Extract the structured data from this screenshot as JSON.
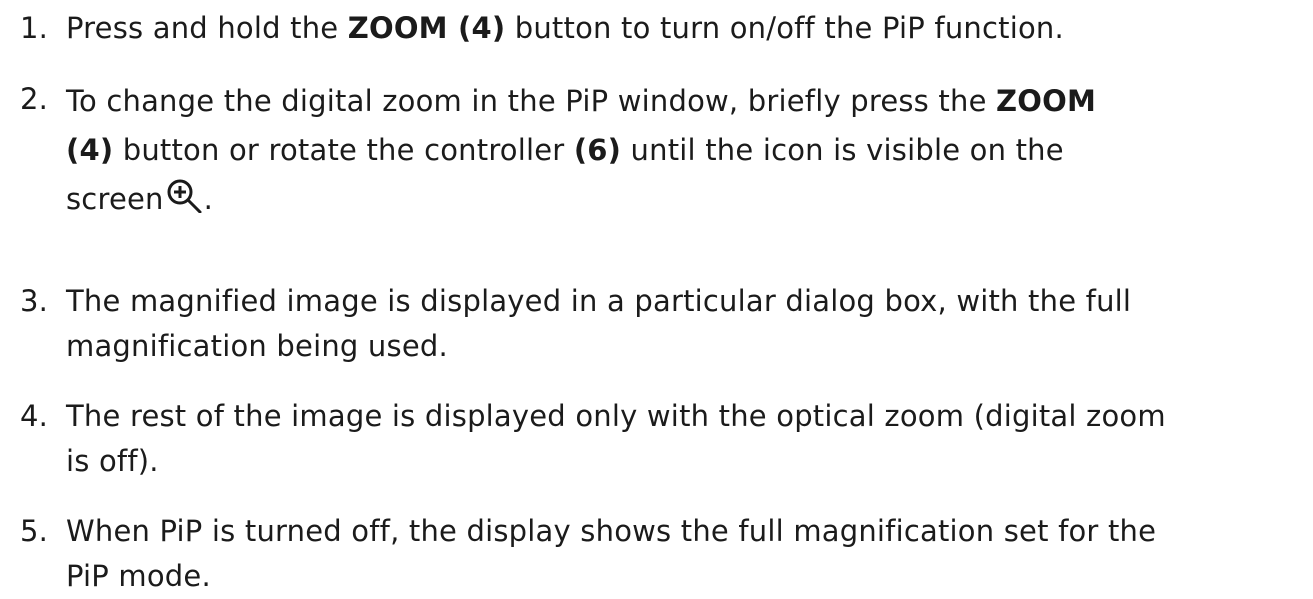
{
  "steps": [
    {
      "number": "1.",
      "parts": {
        "a": "Press and hold the ",
        "b": "ZOOM (4)",
        "c": " button to turn on/off the PiP function."
      }
    },
    {
      "number": "2.",
      "parts": {
        "a": "To change the digital zoom in the PiP window, briefly press the ",
        "b": "ZOOM",
        "c": "(4)",
        "d": " button or rotate the controller ",
        "e": "(6)",
        "f": " until the icon is visible on the",
        "g": "screen",
        "h": "."
      },
      "icon": "zoom-in-magnifier-icon"
    },
    {
      "number": "3.",
      "parts": {
        "a": "The magnified image is displayed in a particular dialog box, with the full",
        "b": "magnification being used."
      }
    },
    {
      "number": "4.",
      "parts": {
        "a": "The rest of the image is displayed only with the optical zoom (digital zoom",
        "b": "is off)."
      }
    },
    {
      "number": "5.",
      "parts": {
        "a": "When PiP is turned off, the display shows the full magnification set for the",
        "b": "PiP mode."
      }
    }
  ]
}
